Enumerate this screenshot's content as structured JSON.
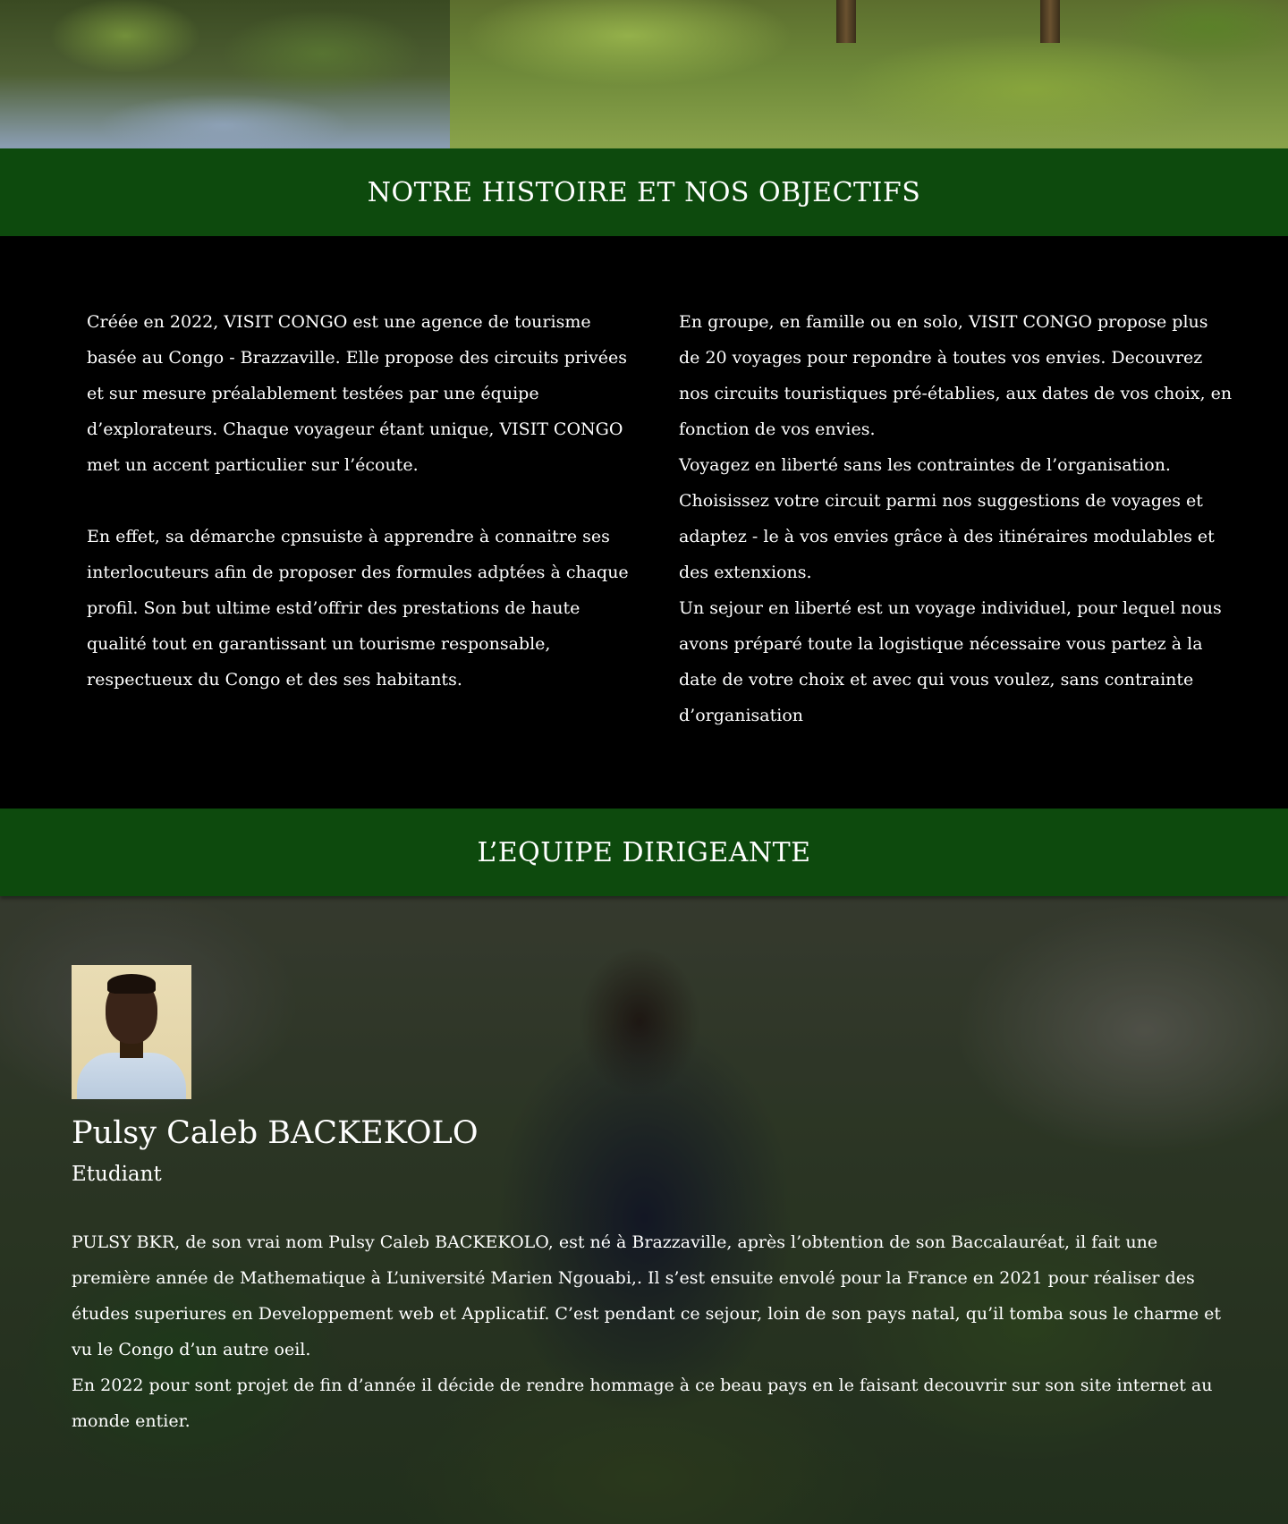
{
  "sections": {
    "story_title": "NOTRE HISTOIRE ET NOS OBJECTIFS",
    "team_title": "L’EQUIPE DIRIGEANTE"
  },
  "story": {
    "left_p1": "Créée en  2022, VISIT CONGO est une agence de tourisme basée au Congo - Brazzaville. Elle propose des circuits privées et sur mesure préalablement testées par une équipe d’explorateurs. Chaque voyageur étant unique, VISIT CONGO met un accent particulier sur l’écoute.",
    "left_p2": "En effet, sa démarche cpnsuiste à apprendre à connaitre ses interlocuteurs afin de proposer des formules adptées à chaque profil. Son but ultime estd’offrir des prestations de haute qualité tout en garantissant un tourisme responsable, respectueux du Congo et des ses habitants.",
    "right_p1": "En groupe, en famille ou en solo, VISIT CONGO propose plus de 20 voyages pour repondre à toutes vos envies. Decouvrez nos circuits touristiques pré-établies, aux dates de vos choix, en fonction de vos envies.",
    "right_p2": "Voyagez en liberté sans les contraintes de l’organisation. Choisissez votre circuit parmi nos suggestions de voyages et adaptez - le à vos envies grâce à des itinéraires modulables et des extenxions.",
    "right_p3": "Un sejour en liberté est un voyage individuel, pour lequel nous avons préparé toute la logistique nécessaire vous partez à la date de votre choix et avec qui vous voulez, sans contrainte d’organisation"
  },
  "member": {
    "name": "Pulsy Caleb BACKEKOLO",
    "role": "Etudiant",
    "bio_p1": "PULSY BKR, de son vrai nom Pulsy Caleb BACKEKOLO, est né à Brazzaville, après l’obtention de son Baccalauréat, il fait une première année de Mathematique à L’université Marien Ngouabi,. Il s’est ensuite envolé pour la France en 2021 pour réaliser des études superiures en Developpement web et Applicatif. C’est pendant ce sejour, loin de son pays  natal, qu’il tomba sous le charme et vu le Congo d’un autre oeil.",
    "bio_p2": "En 2022 pour sont projet de fin d’année il décide de rendre hommage à ce beau pays en le faisant decouvrir sur son site internet au monde entier."
  },
  "colors": {
    "band_green": "#0d4a0d",
    "story_bg": "#000000",
    "text": "#ffffff"
  }
}
